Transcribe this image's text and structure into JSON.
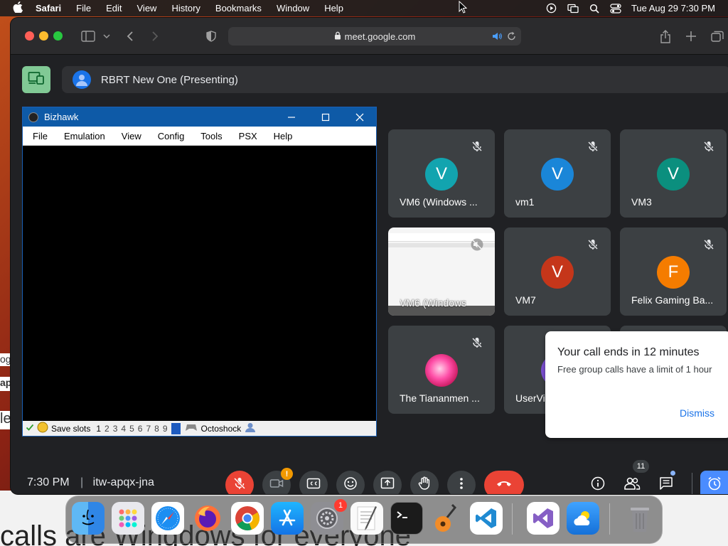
{
  "menubar": {
    "app": "Safari",
    "items": [
      "File",
      "Edit",
      "View",
      "History",
      "Bookmarks",
      "Window",
      "Help"
    ],
    "clock": "Tue Aug 29  7:30 PM"
  },
  "safari": {
    "url": "meet.google.com"
  },
  "meet": {
    "presenting_label": "RBRT New One (Presenting)",
    "time": "7:30 PM",
    "separator": "|",
    "meeting_code": "itw-apqx-jna",
    "participants_count": "11",
    "camera_alert": "!"
  },
  "bizhawk": {
    "title": "Bizhawk",
    "menu": [
      "File",
      "Emulation",
      "View",
      "Config",
      "Tools",
      "PSX",
      "Help"
    ],
    "save_slots_label": "Save slots",
    "slots": [
      "1",
      "2",
      "3",
      "4",
      "5",
      "6",
      "7",
      "8",
      "9"
    ],
    "core_label": "Octoshock"
  },
  "tiles": [
    {
      "name": "VM6 (Windows ...",
      "initial": "V",
      "color": "#12a4af"
    },
    {
      "name": "vm1",
      "initial": "V",
      "color": "#1a86d8"
    },
    {
      "name": "VM3",
      "initial": "V",
      "color": "#0b8f7e"
    },
    {
      "name": "VM6 (Windows",
      "initial": "",
      "color": ""
    },
    {
      "name": "VM7",
      "initial": "V",
      "color": "#c5361a"
    },
    {
      "name": "Felix Gaming Ba...",
      "initial": "F",
      "color": "#f57c00"
    },
    {
      "name": "The Tiananmen ...",
      "initial": "",
      "color": ""
    },
    {
      "name": "UserVi",
      "initial": "",
      "color": ""
    }
  ],
  "notice": {
    "title": "Your call ends in 12 minutes",
    "body": "Free group calls have a limit of 1 hour",
    "dismiss": "Dismiss"
  },
  "dock": {
    "settings_badge": "1"
  },
  "background": {
    "page_text": "calls are Wingdows for everyone"
  }
}
